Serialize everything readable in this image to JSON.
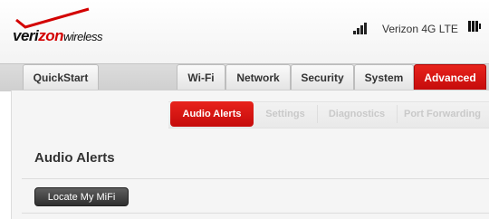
{
  "brand": {
    "logo_part1": "veri",
    "logo_part2": "zon",
    "logo_part3": "wireless"
  },
  "status": {
    "network": "Verizon 4G LTE"
  },
  "nav": {
    "quickstart": "QuickStart",
    "tabs": [
      "Wi-Fi",
      "Network",
      "Security",
      "System",
      "Advanced"
    ],
    "active_tab": "Advanced"
  },
  "subnav": {
    "items": [
      "Audio Alerts",
      "Settings",
      "Diagnostics",
      "Port Forwarding"
    ],
    "active": "Audio Alerts"
  },
  "main": {
    "title": "Audio Alerts",
    "locate_button": "Locate My MiFi"
  },
  "colors": {
    "accent": "#d30000",
    "button_dark": "#3a3a3a"
  }
}
